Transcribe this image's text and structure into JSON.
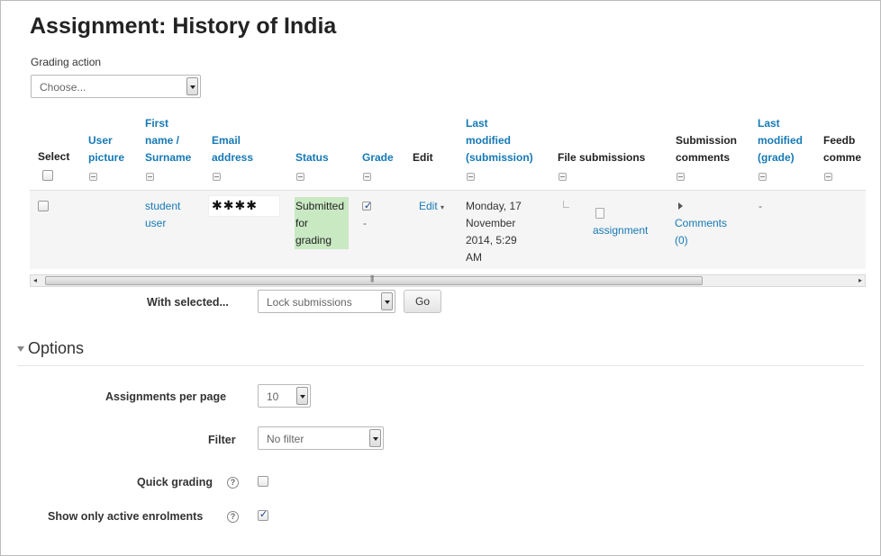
{
  "page": {
    "title": "Assignment: History of India"
  },
  "grading_action": {
    "label": "Grading action",
    "value": "Choose..."
  },
  "table": {
    "headers": {
      "select": "Select",
      "user_picture": [
        "User",
        "picture"
      ],
      "fullname": [
        "First",
        "name /",
        "Surname"
      ],
      "email": [
        "Email",
        "address"
      ],
      "status": "Status",
      "grade": "Grade",
      "edit": "Edit",
      "last_modified_submission": [
        "Last",
        "modified",
        "(submission)"
      ],
      "file_submissions": "File submissions",
      "submission_comments": [
        "Submission",
        "comments"
      ],
      "last_modified_grade": [
        "Last",
        "modified",
        "(grade)"
      ],
      "feedback_comments": [
        "Feedb",
        "comme"
      ]
    },
    "row": {
      "name": [
        "student",
        "user"
      ],
      "email_masked": "✱✱✱✱",
      "status": [
        "Submitted",
        "for",
        "grading"
      ],
      "grade_dash": "-",
      "edit": "Edit",
      "last_modified": [
        "Monday, 17",
        "November",
        "2014, 5:29",
        "AM"
      ],
      "file": "assignment",
      "comments": [
        "Comments",
        "(0)"
      ],
      "last_modified_grade": "-"
    }
  },
  "bulk": {
    "label": "With selected...",
    "value": "Lock submissions",
    "go": "Go"
  },
  "options": {
    "heading": "Options",
    "per_page_label": "Assignments per page",
    "per_page_value": "10",
    "filter_label": "Filter",
    "filter_value": "No filter",
    "quick_grading_label": "Quick grading",
    "active_only_label": "Show only active enrolments",
    "active_only_checked": true,
    "quick_grading_checked": false
  },
  "colors": {
    "link": "#1679b5",
    "status_bg": "#c9e9c3"
  }
}
